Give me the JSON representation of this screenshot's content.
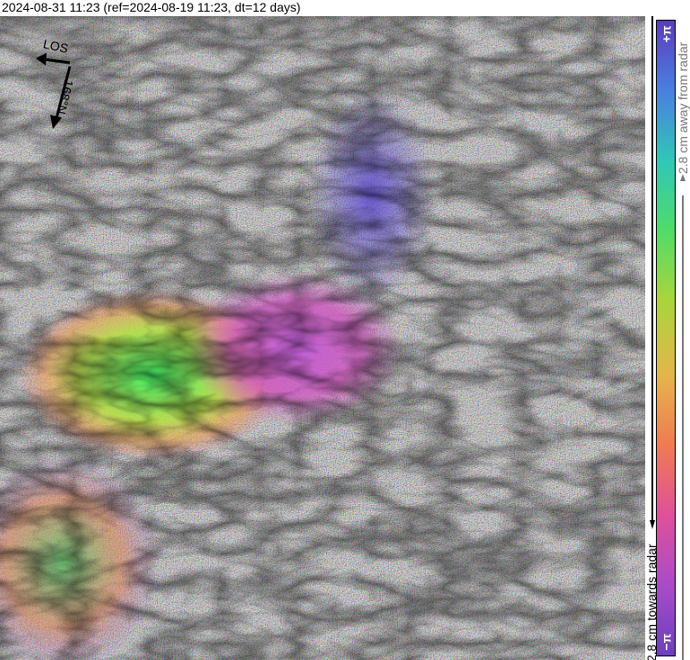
{
  "title": "2024-08-31 11:23 (ref=2024-08-19 11:23, dt=12 days)",
  "compass": {
    "los_label": "LOS",
    "heading_label": "168°N"
  },
  "colorbar": {
    "top_label": "+π",
    "bottom_label": "−π",
    "away_label": "2.8 cm away from radar",
    "towards_label": "2.8 cm towards radar",
    "gradient_colors": [
      "#5b3cbf",
      "#4a7fe0",
      "#2fc7b8",
      "#4fdc68",
      "#a8d63a",
      "#e5b54a",
      "#f07a52",
      "#e0509a",
      "#a84cc7",
      "#6a3fbf"
    ]
  },
  "icons": {
    "los_arrow": "arrow-left-icon",
    "heading_arrow": "arrow-down-icon"
  }
}
